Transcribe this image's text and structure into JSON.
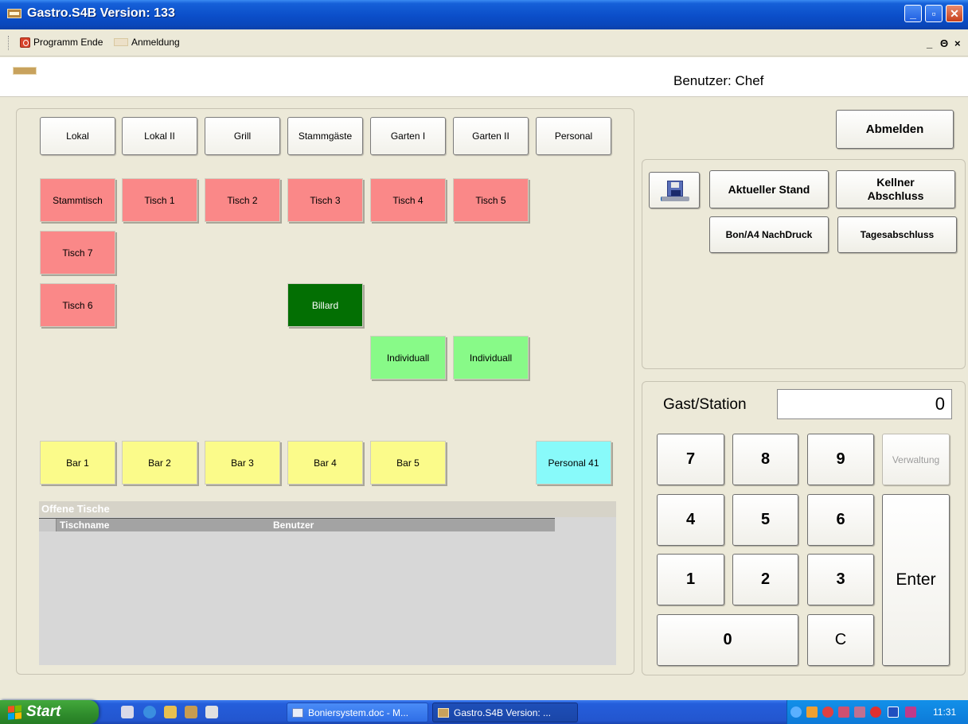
{
  "window": {
    "title": "Gastro.S4B Version:  133"
  },
  "menu": {
    "items": [
      "Programm Ende",
      "Anmeldung"
    ],
    "mdi_minimize": "_",
    "mdi_restore": "Θ",
    "mdi_close": "×"
  },
  "header": {
    "user": "Benutzer: Chef"
  },
  "areas": [
    "Lokal",
    "Lokal II",
    "Grill",
    "Stammgäste",
    "Garten I",
    "Garten II",
    "Personal"
  ],
  "tables": {
    "row1": [
      "Stammtisch",
      "Tisch  1",
      "Tisch  2",
      "Tisch 3",
      "Tisch  4",
      "Tisch  5"
    ],
    "tisch7": "Tisch 7",
    "tisch6": "Tisch 6",
    "billard": "Billard",
    "individual1": "Individuall",
    "individual2": "Individuall",
    "bars": [
      "Bar 1",
      "Bar 2",
      "Bar 3",
      "Bar 4",
      "Bar 5"
    ],
    "personal41": "Personal 41"
  },
  "table_colors": {
    "occupied": "#fa8888",
    "free": "#88fa88",
    "billard": "#036f03",
    "bar": "#fbfb8a",
    "personal": "#88fafa"
  },
  "open_tables": {
    "title": "Offene Tische",
    "columns": [
      "Tischname",
      "Benutzer"
    ],
    "rows": []
  },
  "actions": {
    "logout": "Abmelden",
    "current_status": "Aktueller Stand",
    "waiter_close": "Kellner Abschluss",
    "reprint": "Bon/A4 NachDruck",
    "day_close": "Tagesabschluss",
    "save_icon": "disk-printer-icon"
  },
  "keypad": {
    "station_label": "Gast/Station",
    "station_value": "0",
    "keys": [
      "7",
      "8",
      "9",
      "4",
      "5",
      "6",
      "1",
      "2",
      "3",
      "0",
      "C"
    ],
    "admin": "Verwaltung",
    "enter": "Enter"
  },
  "taskbar": {
    "start": "Start",
    "tasks": [
      "Boniersystem.doc - M...",
      "Gastro.S4B Version:  ..."
    ],
    "clock": "11:31"
  }
}
